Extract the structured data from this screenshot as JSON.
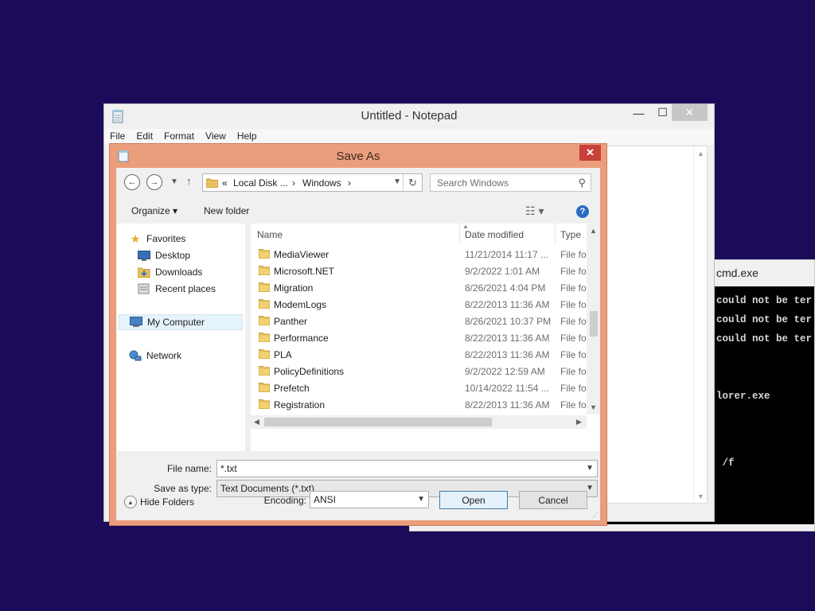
{
  "cmd": {
    "title": "cmd.exe",
    "lines": [
      "could not be ter",
      "could not be ter",
      "could not be ter",
      "lorer.exe",
      " /f"
    ]
  },
  "notepad": {
    "title": "Untitled - Notepad",
    "minimize": "—",
    "maximize": "☐",
    "close": "✕",
    "menu": [
      "File",
      "Edit",
      "Format",
      "View",
      "Help"
    ]
  },
  "dialog": {
    "title": "Save As",
    "close": "✕",
    "breadcrumb": {
      "chevrons": "«",
      "root": "Local Disk ...",
      "folder": "Windows",
      "sep": "›"
    },
    "search": {
      "placeholder": "Search Windows"
    },
    "toolbar": {
      "organize": "Organize ▾",
      "new_folder": "New folder"
    },
    "nav": {
      "favorites": "Favorites",
      "desktop": "Desktop",
      "downloads": "Downloads",
      "recent": "Recent places",
      "computer": "My Computer",
      "network": "Network"
    },
    "columns": {
      "name": "Name",
      "date": "Date modified",
      "type": "Type"
    },
    "files": [
      {
        "name": "MediaViewer",
        "date": "11/21/2014 11:17 ...",
        "type": "File fol"
      },
      {
        "name": "Microsoft.NET",
        "date": "9/2/2022 1:01 AM",
        "type": "File fol"
      },
      {
        "name": "Migration",
        "date": "8/26/2021 4:04 PM",
        "type": "File fol"
      },
      {
        "name": "ModemLogs",
        "date": "8/22/2013 11:36 AM",
        "type": "File fol"
      },
      {
        "name": "Panther",
        "date": "8/26/2021 10:37 PM",
        "type": "File fol"
      },
      {
        "name": "Performance",
        "date": "8/22/2013 11:36 AM",
        "type": "File fol"
      },
      {
        "name": "PLA",
        "date": "8/22/2013 11:36 AM",
        "type": "File fol"
      },
      {
        "name": "PolicyDefinitions",
        "date": "9/2/2022 12:59 AM",
        "type": "File fol"
      },
      {
        "name": "Prefetch",
        "date": "10/14/2022 11:54 ...",
        "type": "File fol"
      },
      {
        "name": "Registration",
        "date": "8/22/2013 11:36 AM",
        "type": "File fol"
      }
    ],
    "form": {
      "filename_label": "File name:",
      "filename_value": "*.txt",
      "savetype_label": "Save as type:",
      "savetype_value": "Text Documents (*.txt)",
      "encoding_label": "Encoding:",
      "encoding_value": "ANSI",
      "open": "Open",
      "cancel": "Cancel",
      "hide_folders": "Hide Folders"
    }
  },
  "colors": {
    "desktop": "#1c0a5a",
    "dialog_frame": "#ea9e7b",
    "close_red": "#c7403a",
    "folder_yellow": "#e8c060"
  }
}
